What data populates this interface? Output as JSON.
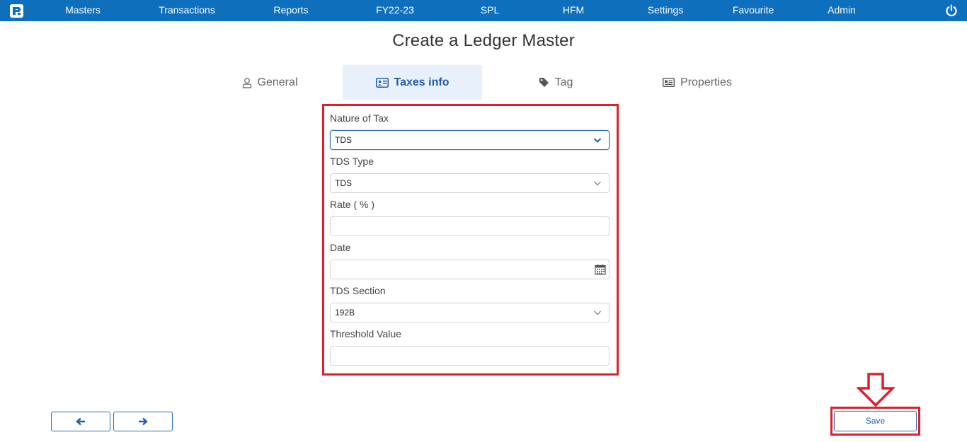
{
  "nav": {
    "items": [
      {
        "label": "Masters"
      },
      {
        "label": "Transactions"
      },
      {
        "label": "Reports"
      },
      {
        "label": "FY22-23"
      },
      {
        "label": "SPL"
      },
      {
        "label": "HFM"
      },
      {
        "label": "Settings"
      },
      {
        "label": "Favourite"
      },
      {
        "label": "Admin"
      }
    ],
    "logo_icon": "app-logo-icon",
    "power_icon": "power-icon"
  },
  "page": {
    "title": "Create a Ledger Master"
  },
  "tabs": [
    {
      "label": "General",
      "icon": "user-icon",
      "active": false
    },
    {
      "label": "Taxes info",
      "icon": "id-card-icon",
      "active": true
    },
    {
      "label": "Tag",
      "icon": "tag-icon",
      "active": false
    },
    {
      "label": "Properties",
      "icon": "list-card-icon",
      "active": false
    }
  ],
  "form": {
    "nature_of_tax": {
      "label": "Nature of Tax",
      "value": "TDS"
    },
    "tds_type": {
      "label": "TDS Type",
      "value": "TDS"
    },
    "rate": {
      "label": "Rate ( % )",
      "value": ""
    },
    "date": {
      "label": "Date",
      "value": ""
    },
    "tds_section": {
      "label": "TDS Section",
      "value": "192B"
    },
    "threshold": {
      "label": "Threshold Value",
      "value": ""
    }
  },
  "footer": {
    "prev_icon": "arrow-left-icon",
    "next_icon": "arrow-right-icon",
    "save_label": "Save"
  },
  "colors": {
    "topbar": "#0e6fbd",
    "highlight": "#e01e2d",
    "accent": "#1f5fa3",
    "active_tab_bg": "#e8f1fb"
  }
}
